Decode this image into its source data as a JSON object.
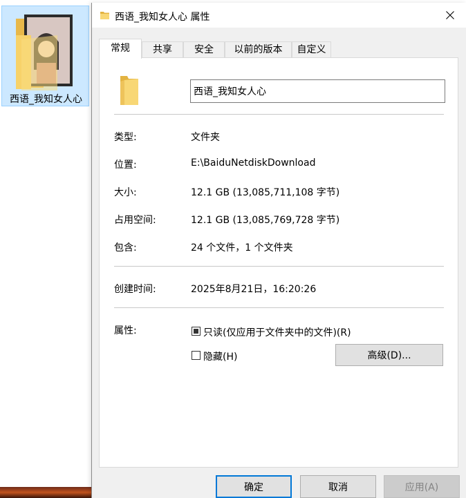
{
  "desktop": {
    "item_label": "西语_我知女人心"
  },
  "dialog": {
    "title": "西语_我知女人心 属性",
    "tabs": [
      {
        "label": "常规",
        "active": true
      },
      {
        "label": "共享",
        "active": false
      },
      {
        "label": "安全",
        "active": false
      },
      {
        "label": "以前的版本",
        "active": false
      },
      {
        "label": "自定义",
        "active": false
      }
    ],
    "name_value": "西语_我知女人心",
    "rows": {
      "type": {
        "label": "类型:",
        "value": "文件夹"
      },
      "location": {
        "label": "位置:",
        "value": "E:\\BaiduNetdiskDownload"
      },
      "size": {
        "label": "大小:",
        "value": "12.1 GB (13,085,711,108 字节)"
      },
      "size_on_disk": {
        "label": "占用空间:",
        "value": "12.1 GB (13,085,769,728 字节)"
      },
      "contains": {
        "label": "包含:",
        "value": "24 个文件，1 个文件夹"
      },
      "created": {
        "label": "创建时间:",
        "value": "2025年8月21日，16:20:26"
      }
    },
    "attributes": {
      "label": "属性:",
      "readonly_label": "只读(仅应用于文件夹中的文件)(R)",
      "readonly_state": "indeterminate",
      "hidden_label": "隐藏(H)",
      "hidden_checked": false,
      "advanced_label": "高级(D)..."
    },
    "buttons": {
      "ok": "确定",
      "cancel": "取消",
      "apply": "应用(A)"
    }
  },
  "colors": {
    "accent": "#0078d7",
    "folder_yellow": "#f8d775",
    "selection": "#cce8ff"
  }
}
